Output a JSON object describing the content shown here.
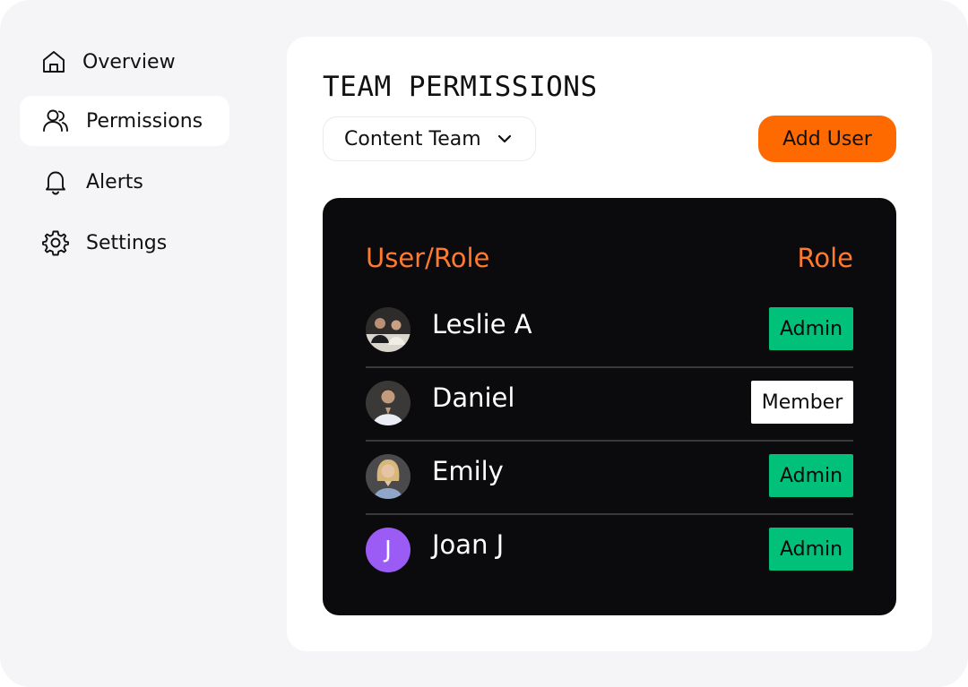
{
  "sidebar": {
    "items": [
      {
        "label": "Overview",
        "icon": "home-icon",
        "active": false
      },
      {
        "label": "Permissions",
        "icon": "users-icon",
        "active": true
      },
      {
        "label": "Alerts",
        "icon": "bell-icon",
        "active": false
      },
      {
        "label": "Settings",
        "icon": "gear-icon",
        "active": false
      }
    ]
  },
  "main": {
    "title": "TEAM PERMISSIONS",
    "team_select": {
      "value": "Content Team"
    },
    "add_user_label": "Add User",
    "table": {
      "headers": {
        "user": "User/Role",
        "role": "Role"
      },
      "rows": [
        {
          "name": "Leslie A",
          "role": "Admin",
          "avatar": "photo"
        },
        {
          "name": "Daniel",
          "role": "Member",
          "avatar": "photo"
        },
        {
          "name": "Emily",
          "role": "Admin",
          "avatar": "photo"
        },
        {
          "name": "Joan J",
          "role": "Admin",
          "avatar": "initial",
          "initial": "J"
        }
      ]
    }
  },
  "colors": {
    "accent": "#ff6a00",
    "header_text": "#ff7a2f",
    "admin_badge": "#00c07a",
    "member_badge": "#ffffff",
    "initial_avatar": "#9b5cf6",
    "panel_bg": "#0b0b0d"
  }
}
